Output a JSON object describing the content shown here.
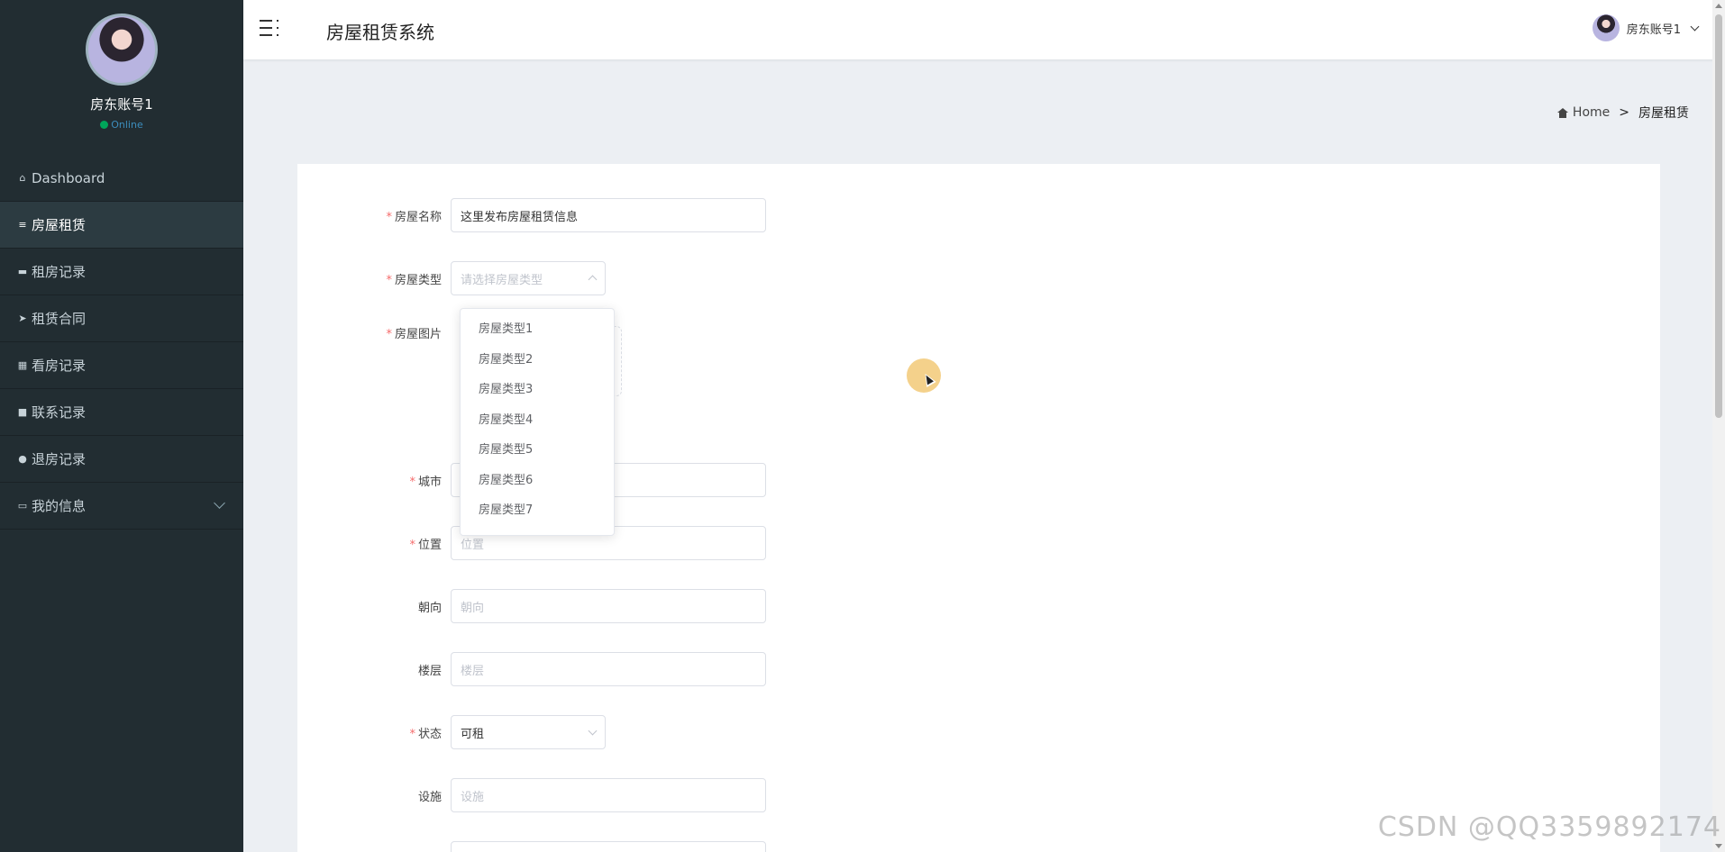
{
  "sidebar": {
    "user_name": "房东账号1",
    "status": "Online",
    "items": [
      {
        "label": "Dashboard",
        "icon": "home-outline-icon"
      },
      {
        "label": "房屋租赁",
        "icon": "sliders-icon"
      },
      {
        "label": "租房记录",
        "icon": "ticket-icon"
      },
      {
        "label": "租赁合同",
        "icon": "send-icon"
      },
      {
        "label": "看房记录",
        "icon": "grid-icon"
      },
      {
        "label": "联系记录",
        "icon": "lock-icon"
      },
      {
        "label": "退房记录",
        "icon": "user-icon"
      },
      {
        "label": "我的信息",
        "icon": "card-icon"
      }
    ]
  },
  "header": {
    "title": "房屋租赁系统",
    "user_name": "房东账号1"
  },
  "breadcrumb": {
    "home": "Home",
    "separator": ">",
    "current": "房屋租赁"
  },
  "form": {
    "name": {
      "label": "房屋名称",
      "value": "这里发布房屋租赁信息"
    },
    "type": {
      "label": "房屋类型",
      "placeholder": "请选择房屋类型"
    },
    "image": {
      "label": "房屋图片"
    },
    "city": {
      "label": "城市"
    },
    "location": {
      "label": "位置",
      "placeholder": "位置"
    },
    "orientation": {
      "label": "朝向",
      "placeholder": "朝向"
    },
    "floor": {
      "label": "楼层",
      "placeholder": "楼层"
    },
    "status": {
      "label": "状态",
      "value": "可租"
    },
    "facilities": {
      "label": "设施",
      "placeholder": "设施"
    }
  },
  "dropdown": {
    "options": [
      "房屋类型1",
      "房屋类型2",
      "房屋类型3",
      "房屋类型4",
      "房屋类型5",
      "房屋类型6",
      "房屋类型7"
    ]
  },
  "watermark": "CSDN @QQ3359892174",
  "colors": {
    "sidebar_bg": "#222d32",
    "sidebar_active": "#2c3b41",
    "online": "#00a65a",
    "required": "#f56c6c"
  }
}
